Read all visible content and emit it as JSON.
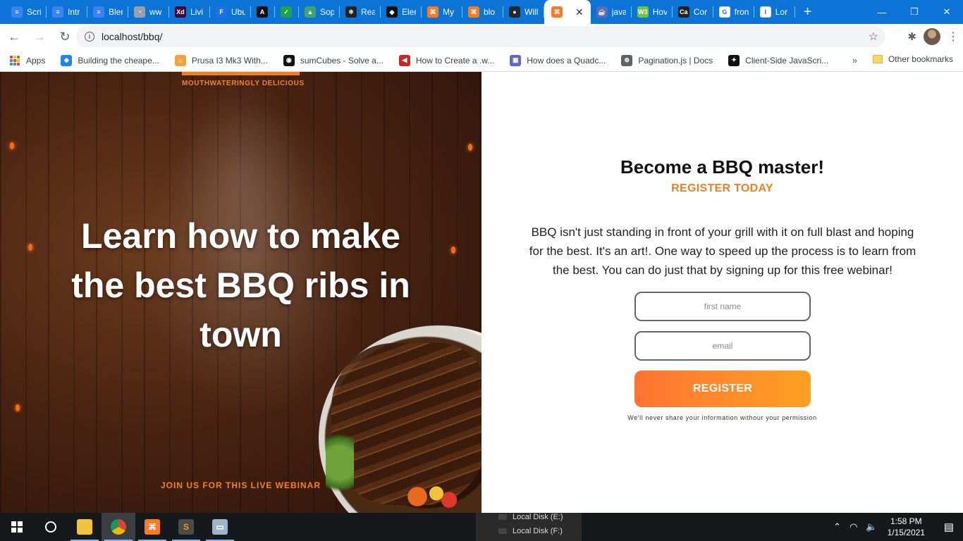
{
  "browser": {
    "tabs": [
      {
        "title": "Scri",
        "fav": "#3b82f6",
        "glyph": "≡"
      },
      {
        "title": "Intr",
        "fav": "#3b82f6",
        "glyph": "≡"
      },
      {
        "title": "Bler",
        "fav": "#3b82f6",
        "glyph": "≡"
      },
      {
        "title": "ww",
        "fav": "#9aa0a6",
        "glyph": "◔"
      },
      {
        "title": "Livi",
        "fav": "#470137",
        "glyph": "Xd"
      },
      {
        "title": "Ubu",
        "fav": "#1f6feb",
        "glyph": "F"
      },
      {
        "title": "",
        "fav": "#111111",
        "glyph": "A"
      },
      {
        "title": "",
        "fav": "#1fa34a",
        "glyph": "✓"
      },
      {
        "title": "Sop",
        "fav": "#3ea36e",
        "glyph": "▲"
      },
      {
        "title": "Rea",
        "fav": "#222222",
        "glyph": "⚛"
      },
      {
        "title": "Eler",
        "fav": "#111111",
        "glyph": "◆"
      },
      {
        "title": "My",
        "fav": "#fb7a24",
        "glyph": "⌘"
      },
      {
        "title": "blo",
        "fav": "#fb7a24",
        "glyph": "⌘"
      },
      {
        "title": "Will",
        "fav": "#24292f",
        "glyph": "●"
      }
    ],
    "active_tab": {
      "fav": "#fb7a24",
      "glyph": "⌘",
      "close": "✕"
    },
    "tabs_after": [
      {
        "title": "java",
        "fav": "#5c6bc0",
        "glyph": "☕"
      },
      {
        "title": "Hov",
        "fav": "#6cc644",
        "glyph": "W3"
      },
      {
        "title": "Cor",
        "fav": "#222222",
        "glyph": "Ca"
      },
      {
        "title": "fron",
        "fav": "#ffffff",
        "glyph": "G"
      },
      {
        "title": "Lor",
        "fav": "#ffffff",
        "glyph": "I"
      }
    ],
    "new_tab": "+",
    "window_controls": {
      "minimize": "—",
      "restore": "❐",
      "close": "✕"
    },
    "url": "localhost/bbq/",
    "bookmarks": [
      {
        "label": "Apps"
      },
      {
        "label": "Building the cheape...",
        "fav": "#1e88e5",
        "glyph": "◆"
      },
      {
        "label": "Prusa I3 Mk3 With...",
        "fav": "#f2a23a",
        "glyph": "☺"
      },
      {
        "label": "sumCubes - Solve a...",
        "fav": "#111111",
        "glyph": "◉"
      },
      {
        "label": "How to Create a .w...",
        "fav": "#c62828",
        "glyph": "◀"
      },
      {
        "label": "How does a Quadc...",
        "fav": "#5c6bc0",
        "glyph": "▣"
      },
      {
        "label": "Pagination.js | Docs",
        "fav": "#5f6368",
        "glyph": "⊕"
      },
      {
        "label": "Client-Side JavaScri...",
        "fav": "#111111",
        "glyph": "✦"
      }
    ],
    "bookmarks_more": "»",
    "other_bookmarks": "Other bookmarks"
  },
  "page": {
    "tagline": "MOUTHWATERINGLY DELICIOUS",
    "headline_part1": "Learn how to make",
    "headline_bold": "the best BBQ ribs",
    "headline_part2": " in town",
    "cta": "JOIN US FOR THIS LIVE WEBINAR",
    "title": "Become a BBQ master!",
    "subtitle": "REGISTER TODAY",
    "description": "BBQ isn't just standing in front of your grill with it on full blast and hoping for the best. It's an art!. One way to speed up the process is to learn from the best. You can do just that by signing up for this free webinar!",
    "first_name_placeholder": "first name",
    "email_placeholder": "email",
    "register_label": "REGISTER",
    "privacy": "We'll never share your information withour your permission"
  },
  "taskbar": {
    "explorer_items": [
      "Local Disk (E:)",
      "Local Disk (F:)"
    ],
    "time": "1:58 PM",
    "date": "1/15/2021",
    "notification_count": "1"
  },
  "colors": {
    "accent_orange": "#f07e22",
    "tab_strip": "#0b74d6",
    "register_gradient_start": "#ff7433",
    "register_gradient_end": "#ffa022"
  }
}
